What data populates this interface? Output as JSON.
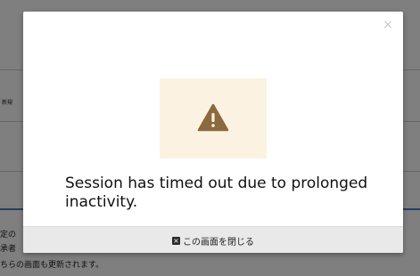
{
  "background": {
    "text_row1": "新規",
    "text_row2a": "定の",
    "text_row2b": "承者",
    "text_row3": "ちらの画面も更新されます。"
  },
  "modal": {
    "close_glyph": "×",
    "icon": "warning-triangle-icon",
    "message": "Session has timed out due to prolonged inactivity.",
    "footer_icon": "close-square-icon",
    "footer_icon_glyph": "×",
    "footer_label": "この画面を閉じる"
  },
  "colors": {
    "warning_icon": "#8a6a3e",
    "warning_bg": "#fcf2e2",
    "footer_bg": "#e9e9e9"
  }
}
